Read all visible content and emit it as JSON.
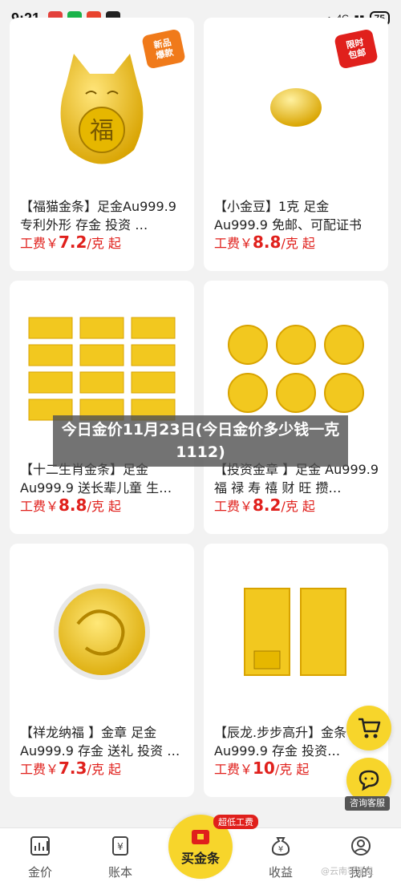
{
  "status": {
    "time": "9:21",
    "network": "4G",
    "battery": "75"
  },
  "products": [
    {
      "title": "【福猫金条】足金Au999.9 专利外形 存金 投资 …",
      "fee_prefix": "工费￥",
      "fee_value": "7.2",
      "fee_suffix": "/克 起",
      "badge": "新品\n爆款",
      "badge_color": "#f07a1a",
      "image": "gold-cat-bar"
    },
    {
      "title": "【小金豆】1克 足金Au999.9 免邮、可配证书",
      "fee_prefix": "工费￥",
      "fee_value": "8.8",
      "fee_suffix": "/克 起",
      "badge": "限时\n包邮",
      "badge_color": "#e0201c",
      "image": "gold-bean"
    },
    {
      "title": "【十二生肖金条】足金 Au999.9 送长辈儿童 生…",
      "fee_prefix": "工费￥",
      "fee_value": "8.8",
      "fee_suffix": "/克 起",
      "image": "zodiac-bars"
    },
    {
      "title": "【投资金章 】足金 Au999.9 福 禄 寿 禧 财 旺 攒…",
      "fee_prefix": "工费￥",
      "fee_value": "8.2",
      "fee_suffix": "/克 起",
      "image": "gold-coins"
    },
    {
      "title": "【祥龙纳福 】金章 足金Au999.9 存金 送礼 投资 …",
      "fee_prefix": "工费￥",
      "fee_value": "7.3",
      "fee_suffix": "/克 起",
      "image": "dragon-coin"
    },
    {
      "title": "【辰龙.步步高升】金条 足金Au999.9 存金 投资…",
      "fee_prefix": "工费￥",
      "fee_value": "10",
      "fee_suffix": "/克 起",
      "image": "dragon-bars"
    }
  ],
  "overlay_title": "今日金价11月23日(今日金价多少钱一克1112)",
  "float": {
    "cart_icon": "cart-icon",
    "service_label": "咨询客服"
  },
  "tabs": [
    {
      "label": "金价",
      "icon": "chart-icon"
    },
    {
      "label": "账本",
      "icon": "ledger-icon"
    },
    {
      "label": "买金条",
      "icon": "gift-icon"
    },
    {
      "label": "收益",
      "icon": "moneybag-icon"
    },
    {
      "label": "我的",
      "icon": "user-icon"
    }
  ],
  "promo_badge": "超低工费",
  "watermark": "@云南零星星"
}
